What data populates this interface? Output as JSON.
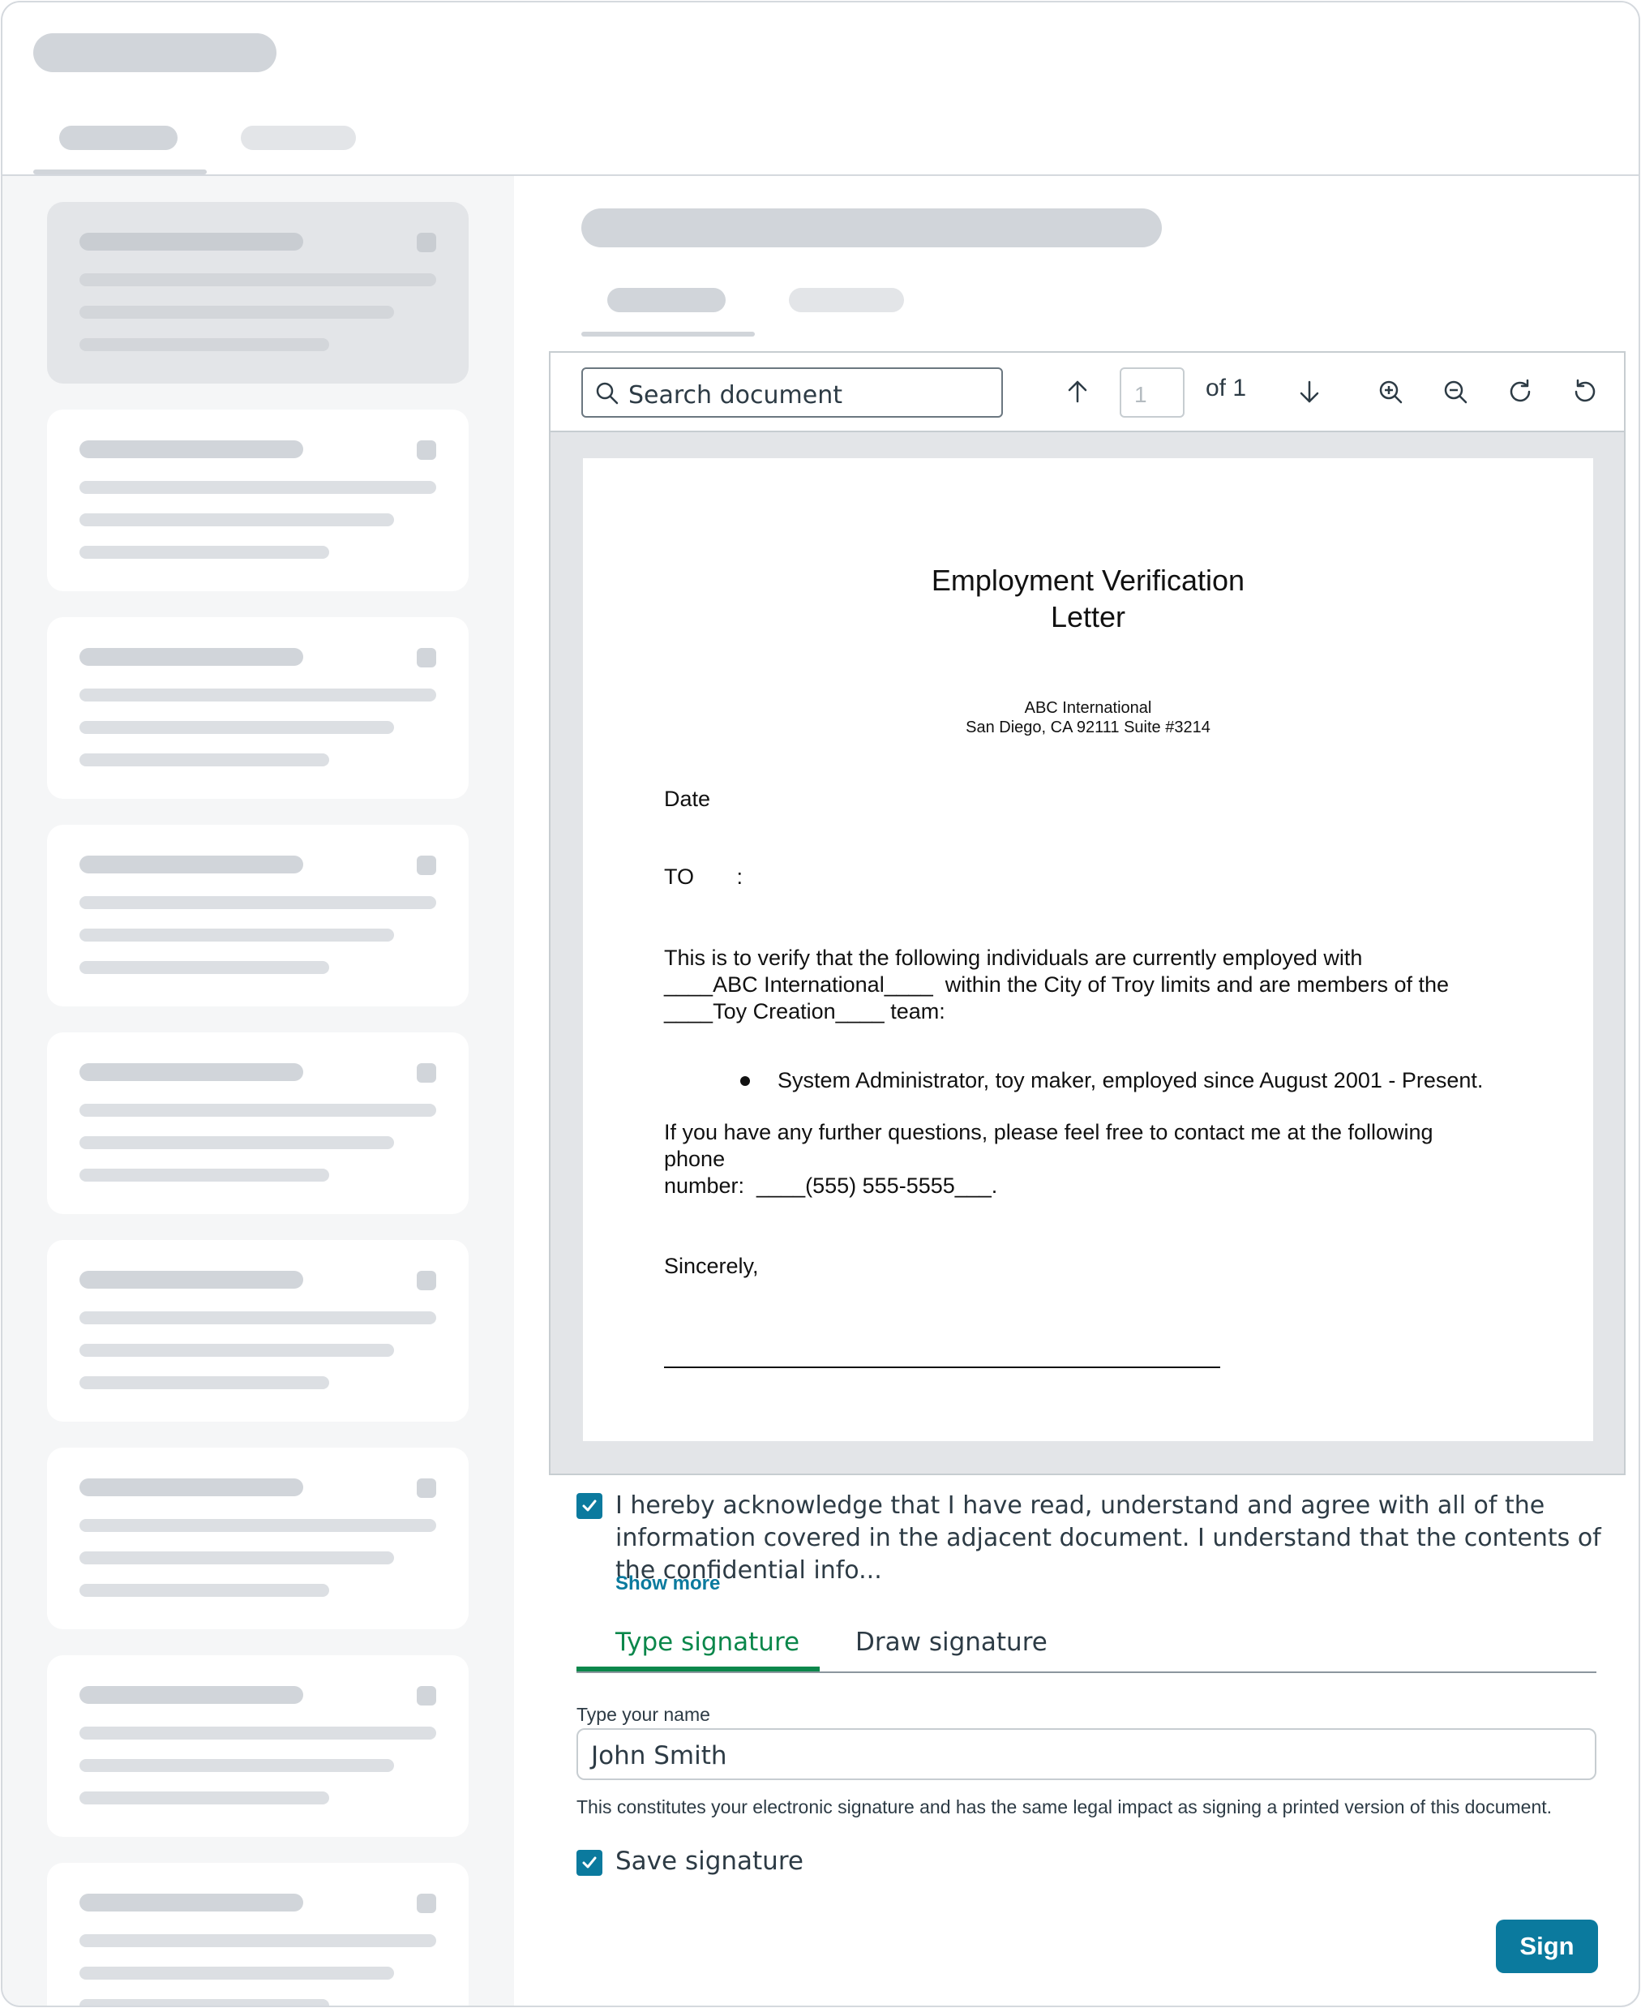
{
  "toolbar": {
    "search_placeholder": "Search document",
    "page_current": "1",
    "page_of": "of 1"
  },
  "document": {
    "title_line1": "Employment Verification",
    "title_line2": "Letter",
    "company": "ABC International",
    "address": "San Diego, CA 92111 Suite #3214",
    "date_label": "Date",
    "to_label": "TO       :",
    "para1_line1": "This is to verify that the following individuals are currently employed with",
    "para1_line2": "____ABC International____  within the City of Troy limits and are members of the",
    "para1_line3": "____Toy Creation____ team:",
    "bullet1": "System Administrator, toy maker, employed since August 2001 - Present.",
    "para2_line1": "If you have any further questions, please feel free to contact me at the following",
    "para2_line2": "phone",
    "para2_line3": "number:  ____(555) 555-5555___.",
    "closing": "Sincerely,"
  },
  "acknowledgement": {
    "text": "I hereby acknowledge that I have read, understand and agree with all of the information covered in the adjacent document. I understand that the contents of the confidential info...",
    "show_more": "Show more",
    "checked": true
  },
  "signature": {
    "tabs": [
      "Type signature",
      "Draw signature"
    ],
    "active_tab": "Type signature",
    "name_label": "Type your name",
    "name_value": "John Smith",
    "hint": "This constitutes your electronic signature and has the same legal impact as signing a printed version of this document.",
    "save_label": "Save signature",
    "save_checked": true,
    "sign_button": "Sign"
  },
  "colors": {
    "accent": "#0b7a9e",
    "tab_active": "#0b874b",
    "skeleton": "#d1d5da"
  }
}
